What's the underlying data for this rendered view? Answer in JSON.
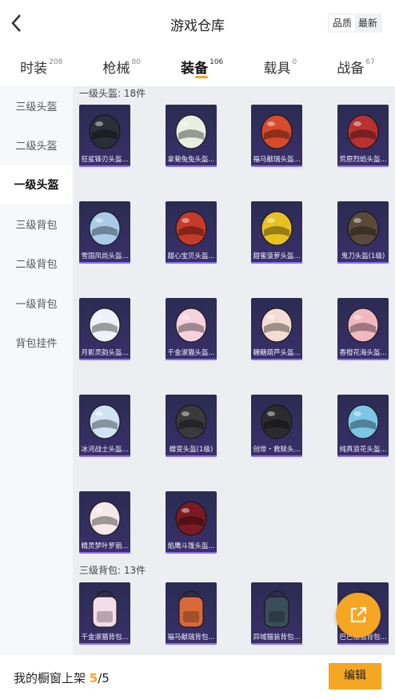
{
  "header": {
    "title": "游戏仓库",
    "sort": [
      "品质",
      "最新"
    ]
  },
  "tabs": [
    {
      "label": "时装",
      "count": "208"
    },
    {
      "label": "枪械",
      "count": "80"
    },
    {
      "label": "装备",
      "count": "106"
    },
    {
      "label": "载具",
      "count": "0"
    },
    {
      "label": "战备",
      "count": "67"
    }
  ],
  "sidebar": [
    "三级头盔",
    "二级头盔",
    "一级头盔",
    "三级背包",
    "二级背包",
    "一级背包",
    "背包挂件"
  ],
  "sections": {
    "helmets": {
      "title": "一级头盔: 18件",
      "items": [
        {
          "name": "狂鲨锋刃头盔...",
          "color": "#2a2f3a"
        },
        {
          "name": "拿菊兔兔头盔...",
          "color": "#e9efe0"
        },
        {
          "name": "福马献瑞头盔...",
          "color": "#d84a2c"
        },
        {
          "name": "荒原烈焰头盔...",
          "color": "#b83232"
        },
        {
          "name": "雪国凤尚头盔...",
          "color": "#a9cbe8"
        },
        {
          "name": "甜心宝贝头盔...",
          "color": "#c63a2a"
        },
        {
          "name": "甜蜜菠萝头盔...",
          "color": "#e8c220"
        },
        {
          "name": "鬼刀头盔(1级)",
          "color": "#5a4a3a"
        },
        {
          "name": "月影灵韵头盔...",
          "color": "#eef2f8"
        },
        {
          "name": "千金淑猫头盔...",
          "color": "#f6d2dc"
        },
        {
          "name": "糖糖葫芦头盔...",
          "color": "#f3ddd2"
        },
        {
          "name": "香橙花海头盔...",
          "color": "#f1b8c0"
        },
        {
          "name": "冰河战士头盔...",
          "color": "#cfe3f3"
        },
        {
          "name": "蝶变头盔(1级)",
          "color": "#3a3a3e"
        },
        {
          "name": "创世・救赎头...",
          "color": "#2c2c30"
        },
        {
          "name": "纯真浪花头盔...",
          "color": "#7cc6e6"
        },
        {
          "name": "精灵梦叶罗丽...",
          "color": "#f4e8e8"
        },
        {
          "name": "焰鹰斗篷头盔...",
          "color": "#7a1a22"
        }
      ]
    },
    "backpacks": {
      "title": "三级背包: 13件",
      "items": [
        {
          "name": "千金淑猫背包...",
          "color": "#f3dde6"
        },
        {
          "name": "福马献瑞背包...",
          "color": "#d86a3a"
        },
        {
          "name": "异域猫装背包...",
          "color": "#3a4e5a"
        },
        {
          "name": "巴巴猫猫背包...",
          "color": "#6a4a3a"
        }
      ]
    }
  },
  "bottom": {
    "shelf_label": "我的橱窗上架",
    "current": "5",
    "total": "/5",
    "edit": "编辑"
  },
  "icons": [
    "back-arrow-icon",
    "share-external-icon"
  ],
  "colors": {
    "accent": "#f5a623",
    "card_bg": "#2f2d5a",
    "rarity_bar": "#8b6bff"
  }
}
